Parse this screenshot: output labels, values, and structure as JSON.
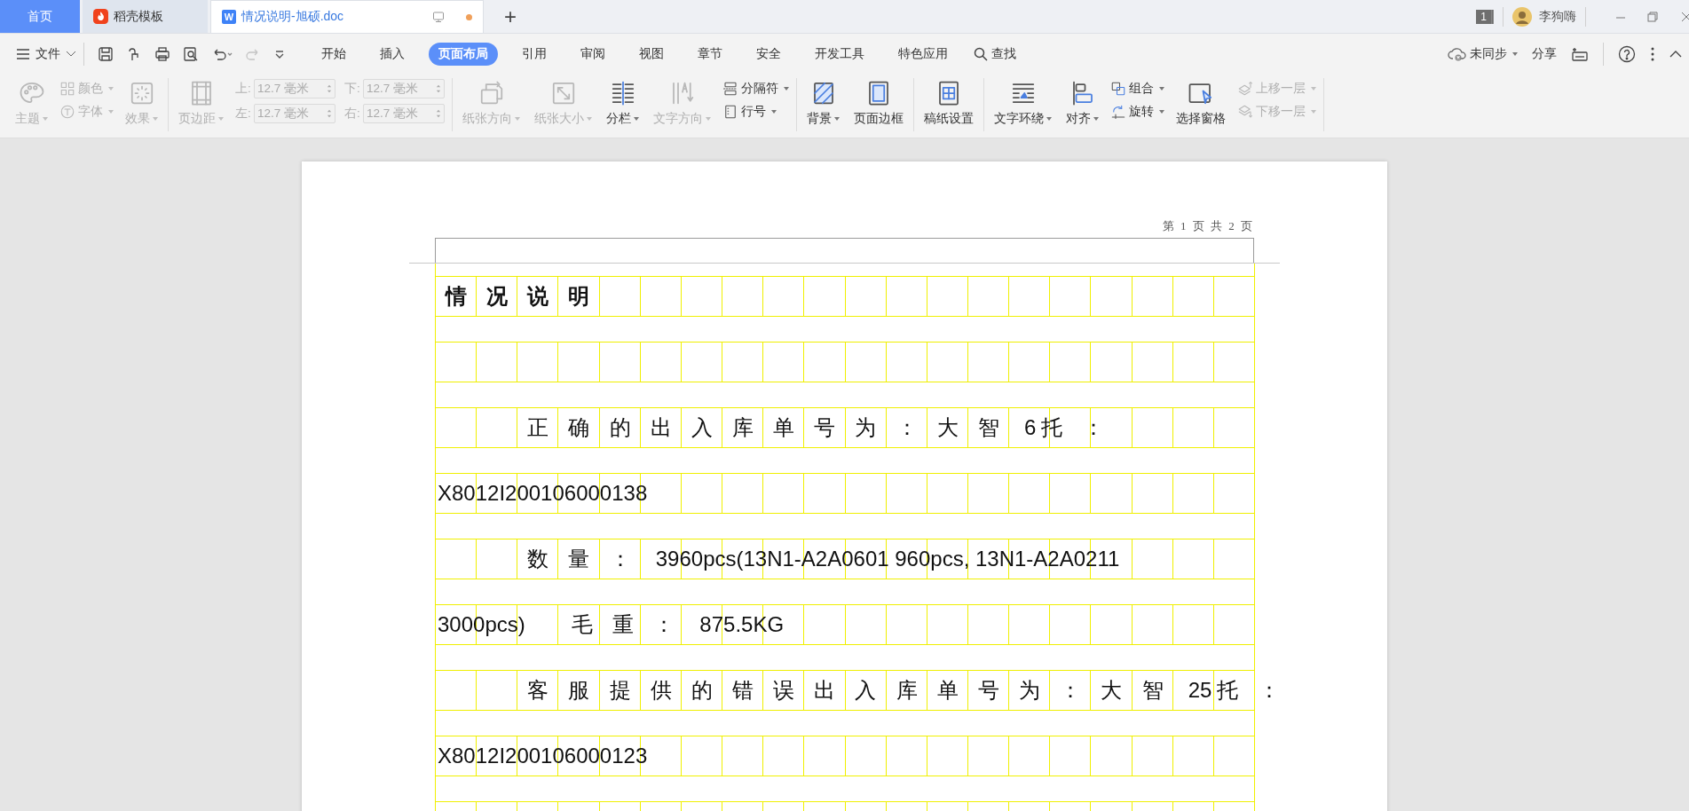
{
  "tabs": [
    {
      "label": "首页",
      "kind": "home",
      "selected": false
    },
    {
      "label": "稻壳模板",
      "kind": "docer",
      "selected": false
    },
    {
      "label": "情况说明-旭硕.doc",
      "kind": "document",
      "badge": "W",
      "selected": true,
      "unsaved": true
    }
  ],
  "new_tab": "+",
  "account": {
    "badge": "1",
    "name": "李狗嗨"
  },
  "quick_access": {
    "redo_disabled": true
  },
  "menu": {
    "file": "文件",
    "tabs": [
      {
        "label": "开始",
        "selected": false
      },
      {
        "label": "插入",
        "selected": false
      },
      {
        "label": "页面布局",
        "selected": true
      },
      {
        "label": "引用",
        "selected": false
      },
      {
        "label": "审阅",
        "selected": false
      },
      {
        "label": "视图",
        "selected": false
      },
      {
        "label": "章节",
        "selected": false
      },
      {
        "label": "安全",
        "selected": false
      },
      {
        "label": "开发工具",
        "selected": false
      },
      {
        "label": "特色应用",
        "selected": false
      }
    ],
    "search": "查找",
    "sync": "未同步",
    "share": "分享"
  },
  "ribbon": [
    {
      "columns": [
        {
          "kind": "large",
          "label": "主题",
          "dropdown": true,
          "disabled": true
        },
        {
          "kind": "stack",
          "items": [
            {
              "label": "颜色",
              "dropdown": true,
              "disabled": true
            },
            {
              "label": "字体",
              "dropdown": true,
              "disabled": true
            }
          ]
        },
        {
          "kind": "large",
          "label": "效果",
          "dropdown": true,
          "disabled": true
        }
      ]
    },
    {
      "columns": [
        {
          "kind": "large",
          "label": "页边距",
          "dropdown": true,
          "disabled": true
        },
        {
          "kind": "fields",
          "items": [
            {
              "label": "上:",
              "value": "12.7 毫米",
              "disabled": true
            },
            {
              "label": "左:",
              "value": "12.7 毫米",
              "disabled": true
            }
          ]
        },
        {
          "kind": "fields",
          "items": [
            {
              "label": "下:",
              "value": "12.7 毫米",
              "disabled": true
            },
            {
              "label": "右:",
              "value": "12.7 毫米",
              "disabled": true
            }
          ]
        }
      ]
    },
    {
      "columns": [
        {
          "kind": "large",
          "label": "纸张方向",
          "dropdown": true,
          "disabled": true
        },
        {
          "kind": "large",
          "label": "纸张大小",
          "dropdown": true,
          "disabled": true
        },
        {
          "kind": "large",
          "label": "分栏",
          "dropdown": true,
          "disabled": false
        },
        {
          "kind": "large",
          "label": "文字方向",
          "dropdown": true,
          "disabled": true
        },
        {
          "kind": "stack",
          "items": [
            {
              "label": "分隔符",
              "dropdown": true,
              "disabled": false
            },
            {
              "label": "行号",
              "dropdown": true,
              "disabled": false
            }
          ]
        }
      ]
    },
    {
      "columns": [
        {
          "kind": "large",
          "label": "背景",
          "dropdown": true,
          "disabled": false
        },
        {
          "kind": "large",
          "label": "页面边框",
          "dropdown": false,
          "disabled": false
        }
      ]
    },
    {
      "columns": [
        {
          "kind": "large",
          "label": "稿纸设置",
          "dropdown": false,
          "disabled": false
        }
      ]
    },
    {
      "columns": [
        {
          "kind": "large",
          "label": "文字环绕",
          "dropdown": true,
          "disabled": false
        },
        {
          "kind": "large",
          "label": "对齐",
          "dropdown": true,
          "disabled": false
        },
        {
          "kind": "stack",
          "items": [
            {
              "label": "组合",
              "dropdown": true,
              "disabled": false
            },
            {
              "label": "旋转",
              "dropdown": true,
              "disabled": false
            }
          ]
        },
        {
          "kind": "large",
          "label": "选择窗格",
          "dropdown": false,
          "disabled": false
        },
        {
          "kind": "stack",
          "items": [
            {
              "label": "上移一层",
              "dropdown": true,
              "disabled": true
            },
            {
              "label": "下移一层",
              "dropdown": true,
              "disabled": true
            }
          ]
        }
      ]
    }
  ],
  "document": {
    "header": "第 1 页 共 2 页",
    "title": "情况说明",
    "lines": [
      {
        "indent": true,
        "segments": [
          {
            "kind": "cjk",
            "text": "正确的出入库单号为：大智"
          },
          {
            "kind": "latin",
            "text": "6"
          },
          {
            "kind": "cjk",
            "text": "托："
          }
        ]
      },
      {
        "indent": false,
        "segments": [
          {
            "kind": "latin",
            "text": "X8012I200106000138"
          }
        ]
      },
      {
        "indent": true,
        "segments": [
          {
            "kind": "cjk",
            "text": "数量："
          },
          {
            "kind": "latin",
            "text": "3960pcs(13N1-A2A0601 960pcs, 13N1-A2A0211"
          }
        ]
      },
      {
        "indent": false,
        "segments": [
          {
            "kind": "latin",
            "text": "3000pcs)"
          },
          {
            "kind": "cjk",
            "text": "　毛重："
          },
          {
            "kind": "latin",
            "text": "875.5KG"
          }
        ]
      },
      {
        "indent": true,
        "segments": [
          {
            "kind": "cjk",
            "text": "客服提供的错误出入库单号为：大智"
          },
          {
            "kind": "latin",
            "text": "25"
          },
          {
            "kind": "cjk",
            "text": "托："
          }
        ]
      },
      {
        "indent": false,
        "segments": [
          {
            "kind": "latin",
            "text": "X8012I200106000123"
          }
        ]
      }
    ]
  }
}
